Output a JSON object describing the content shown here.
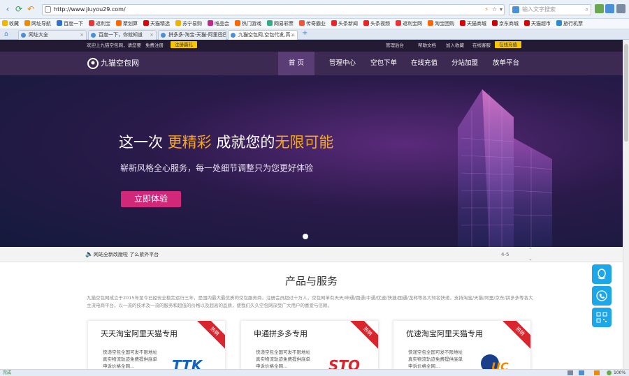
{
  "browser": {
    "url": "http://www.jiuyou29.com/",
    "search_placeholder": "输入文字搜索",
    "bookmarks": [
      {
        "label": "收藏",
        "color": "#f5b400"
      },
      {
        "label": "网址导航",
        "color": "#f08a00"
      },
      {
        "label": "百度一下",
        "color": "#2d6fd6"
      },
      {
        "label": "返利宝",
        "color": "#e33"
      },
      {
        "label": "聚划算",
        "color": "#f60"
      },
      {
        "label": "天猫精选",
        "color": "#d00"
      },
      {
        "label": "苏宁易购",
        "color": "#f3b000"
      },
      {
        "label": "唯品会",
        "color": "#c0268c"
      },
      {
        "label": "热门游戏",
        "color": "#f60"
      },
      {
        "label": "网易彩票",
        "color": "#3a8"
      },
      {
        "label": "传奇霸业",
        "color": "#e53"
      },
      {
        "label": "头条新闻",
        "color": "#e22"
      },
      {
        "label": "头条视频",
        "color": "#e22"
      },
      {
        "label": "返利宝网",
        "color": "#e33"
      },
      {
        "label": "淘宝团购",
        "color": "#f60"
      },
      {
        "label": "天猫商城",
        "color": "#d00"
      },
      {
        "label": "京东商城",
        "color": "#c00"
      },
      {
        "label": "天猫超市",
        "color": "#d00"
      },
      {
        "label": "旅行机票",
        "color": "#2a8ad8"
      }
    ],
    "tabs": [
      {
        "label": "网址大全",
        "active": false
      },
      {
        "label": "百度一下，你就知道",
        "active": false
      },
      {
        "label": "拼多多-淘宝-天猫-阿里巴巴",
        "active": false
      },
      {
        "label": "九猫空包网,空包代发,高...",
        "active": true
      }
    ],
    "status_left": "完成",
    "zoom": "100%"
  },
  "site": {
    "topbar": {
      "welcome": "欢迎上九猫空包网，请您要",
      "login": "免费注册",
      "register_btn": "注册赢礼",
      "links": [
        "管理后台",
        "帮助文档",
        "加入收藏",
        "在线客服"
      ],
      "recharge_btn": "在线充值"
    },
    "logo": "九猫空包网",
    "nav": [
      "首 页",
      "管理中心",
      "空包下单",
      "在线充值",
      "分站加盟",
      "放单平台"
    ],
    "hero": {
      "headline_1": "这一次",
      "headline_2": "更精彩",
      "headline_3": "成就您的",
      "headline_4": "无限可能",
      "subtitle": "崭新风格全心服务，每一处细节调整只为您更好体验",
      "cta": "立即体验"
    },
    "notice": {
      "text": "网站全新改版啦 了么紧外平台",
      "pager": "4-5"
    },
    "products": {
      "title": "产品与服务",
      "intro": "九猫空包网成立于2015年至今已经安全稳定运行三年，是国内最大最优质的空包服务商，注册会员超过十万人，空包网单有天天/申通/圆通/中通/优速/快捷/国通/龙邦等各大知名快递，支持淘宝/天猫/阿里/京东/拼多多等各大主流电商平台，以一流的技术及一流的服务和超低的价格以及超高的品质，使我们久久空包网深受广大用户的喜爱与信赖。",
      "cards": [
        {
          "title": "天天淘宝阿里天猫专用",
          "desc": "快递空包全国可发不限地址 真实物流轨迹免费提供底单 申诉价格全网...",
          "badge": "热销",
          "logo": "TTK"
        },
        {
          "title": "申通拼多多专用",
          "desc": "快递空包全国可发不限地址 真实物流轨迹免费提供底单 申诉价格全网...",
          "badge": "热销",
          "logo": "STO"
        },
        {
          "title": "优速淘宝阿里天猫专用",
          "desc": "快递空包全国可发不限地址 真实物流轨迹免费提供底单 申诉价格全网...",
          "badge": "热销",
          "logo": "UC"
        }
      ]
    }
  },
  "colors": {
    "accent": "#f7c600",
    "nav_bg": "#3d2a52",
    "cta": "#d1287a",
    "ribbon": "#d8262f",
    "float": "#1ea7e8"
  }
}
